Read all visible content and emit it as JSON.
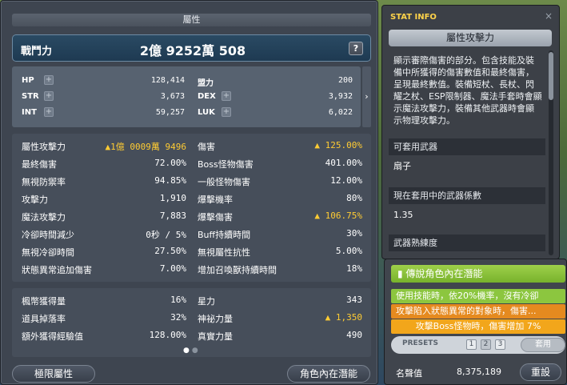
{
  "stat_window": {
    "title": "屬性",
    "combat_power_label": "戰鬥力",
    "combat_power_value": "2億 9252萬 508",
    "help_label": "?",
    "basic_stats": [
      {
        "name": "HP",
        "value": "128,414"
      },
      {
        "name": "盟力",
        "value": "200"
      },
      {
        "name": "STR",
        "value": "3,673"
      },
      {
        "name": "DEX",
        "value": "3,932"
      },
      {
        "name": "INT",
        "value": "59,257"
      },
      {
        "name": "LUK",
        "value": "6,022"
      }
    ],
    "details": [
      {
        "n1": "屬性攻擊力",
        "v1": "▲1億 0009萬 9496",
        "v1_gold": true,
        "n2": "傷害",
        "v2": "▲ 125.00%",
        "v2_gold": true
      },
      {
        "n1": "最終傷害",
        "v1": "72.00%",
        "n2": "Boss怪物傷害",
        "v2": "401.00%"
      },
      {
        "n1": "無視防禦率",
        "v1": "94.85%",
        "n2": "一般怪物傷害",
        "v2": "12.00%"
      },
      {
        "n1": "攻擊力",
        "v1": "1,910",
        "n2": "爆擊機率",
        "v2": "80%"
      },
      {
        "n1": "魔法攻擊力",
        "v1": "7,883",
        "n2": "爆擊傷害",
        "v2": "▲ 106.75%",
        "v2_gold": true
      },
      {
        "n1": "冷卻時間減少",
        "v1": "0秒 / 5%",
        "n2": "Buff持續時間",
        "v2": "30%"
      },
      {
        "n1": "無視冷卻時間",
        "v1": "27.50%",
        "n2": "無視屬性抗性",
        "v2": "5.00%"
      },
      {
        "n1": "狀態異常追加傷害",
        "v1": "7.00%",
        "n2": "增加召喚獸持續時間",
        "v2": "18%"
      }
    ],
    "extras": [
      {
        "n1": "楓幣獲得量",
        "v1": "16%",
        "n2": "星力",
        "v2": "343"
      },
      {
        "n1": "道具掉落率",
        "v1": "32%",
        "n2": "神祕力量",
        "v2": "▲ 1,350",
        "v2_gold": true
      },
      {
        "n1": "額外獲得經驗值",
        "v1": "128.00%",
        "n2": "真實力量",
        "v2": "490"
      }
    ],
    "page_dots": [
      "●",
      "●"
    ],
    "hyper_stat_button": "極限屬性",
    "inner_ability_button": "角色內在潛能",
    "side_arrow": "›"
  },
  "stat_info": {
    "header": "STAT INFO",
    "close": "×",
    "title": "屬性攻擊力",
    "description": "顯示審際傷害的部分。包含技能及裝備中所獲得的傷害數值和最終傷害，呈現最終數值。裝備短杖、長杖、閃耀之杖、ESP限制器、魔法手套時會顯示魔法攻擊力，裝備其他武器時會顯示物理攻擊力。",
    "usable_weapon_label": "可套用武器",
    "usable_weapon_value": "扇子",
    "weapon_coef_label": "現在套用中的武器係數",
    "weapon_coef_value": "1.35",
    "weapon_mastery_label": "武器熟練度"
  },
  "inner_ability": {
    "title": "傳說角色內在潛能",
    "lines": [
      {
        "text": "使用技能時，依20%機率，沒有冷卻",
        "style": "green"
      },
      {
        "text": "攻擊陷入狀態異常的對象時，傷害...",
        "style": "orange"
      },
      {
        "text": "攻擊Boss怪物時，傷害增加 7%",
        "style": "gold"
      }
    ],
    "presets_label": "PRESETS",
    "presets": [
      "1",
      "2",
      "3"
    ],
    "apply_button": "套用",
    "honor_label": "名聲值",
    "honor_value": "8,375,189",
    "reset_button": "重設"
  },
  "colors": {
    "gold_text": "#ffcc33",
    "legend_green": "#8cc63f",
    "orange": "#e58a1f"
  }
}
